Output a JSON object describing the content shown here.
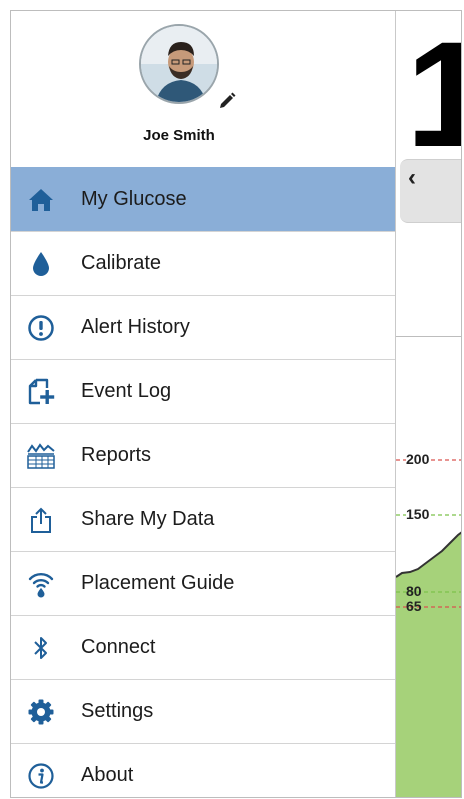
{
  "user": {
    "name": "Joe Smith"
  },
  "main": {
    "reading_partial": "1",
    "back_chevron": "‹",
    "graph_labels": [
      "200",
      "150",
      "80",
      "65"
    ]
  },
  "menu": {
    "items": [
      {
        "label": "My Glucose",
        "icon": "home-icon",
        "active": true
      },
      {
        "label": "Calibrate",
        "icon": "drop-icon"
      },
      {
        "label": "Alert History",
        "icon": "alert-circle-icon"
      },
      {
        "label": "Event Log",
        "icon": "event-log-add-icon"
      },
      {
        "label": "Reports",
        "icon": "reports-chart-icon"
      },
      {
        "label": "Share My Data",
        "icon": "share-icon"
      },
      {
        "label": "Placement Guide",
        "icon": "placement-signal-icon"
      },
      {
        "label": "Connect",
        "icon": "bluetooth-icon"
      },
      {
        "label": "Settings",
        "icon": "gear-icon"
      },
      {
        "label": "About",
        "icon": "info-icon"
      }
    ]
  },
  "colors": {
    "active_bg": "#8aaed7",
    "icon_blue": "#1f5f99",
    "high_line": "#d9534f",
    "target_line": "#7cc24a",
    "graph_fill": "#9fcf6e"
  }
}
